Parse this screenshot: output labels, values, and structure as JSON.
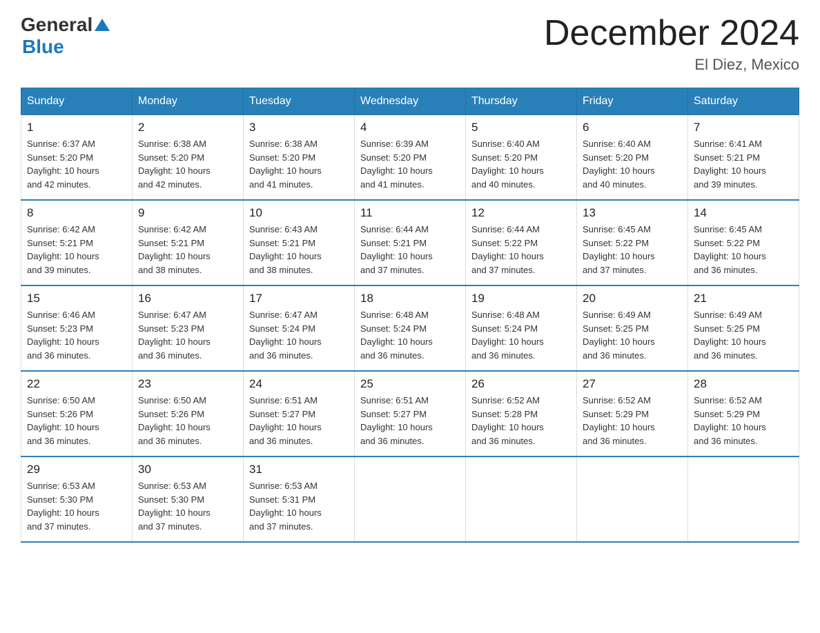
{
  "header": {
    "logo_general": "General",
    "logo_blue": "Blue",
    "month_year": "December 2024",
    "location": "El Diez, Mexico"
  },
  "days_of_week": [
    "Sunday",
    "Monday",
    "Tuesday",
    "Wednesday",
    "Thursday",
    "Friday",
    "Saturday"
  ],
  "weeks": [
    [
      {
        "day": "1",
        "sunrise": "6:37 AM",
        "sunset": "5:20 PM",
        "daylight": "10 hours and 42 minutes."
      },
      {
        "day": "2",
        "sunrise": "6:38 AM",
        "sunset": "5:20 PM",
        "daylight": "10 hours and 42 minutes."
      },
      {
        "day": "3",
        "sunrise": "6:38 AM",
        "sunset": "5:20 PM",
        "daylight": "10 hours and 41 minutes."
      },
      {
        "day": "4",
        "sunrise": "6:39 AM",
        "sunset": "5:20 PM",
        "daylight": "10 hours and 41 minutes."
      },
      {
        "day": "5",
        "sunrise": "6:40 AM",
        "sunset": "5:20 PM",
        "daylight": "10 hours and 40 minutes."
      },
      {
        "day": "6",
        "sunrise": "6:40 AM",
        "sunset": "5:20 PM",
        "daylight": "10 hours and 40 minutes."
      },
      {
        "day": "7",
        "sunrise": "6:41 AM",
        "sunset": "5:21 PM",
        "daylight": "10 hours and 39 minutes."
      }
    ],
    [
      {
        "day": "8",
        "sunrise": "6:42 AM",
        "sunset": "5:21 PM",
        "daylight": "10 hours and 39 minutes."
      },
      {
        "day": "9",
        "sunrise": "6:42 AM",
        "sunset": "5:21 PM",
        "daylight": "10 hours and 38 minutes."
      },
      {
        "day": "10",
        "sunrise": "6:43 AM",
        "sunset": "5:21 PM",
        "daylight": "10 hours and 38 minutes."
      },
      {
        "day": "11",
        "sunrise": "6:44 AM",
        "sunset": "5:21 PM",
        "daylight": "10 hours and 37 minutes."
      },
      {
        "day": "12",
        "sunrise": "6:44 AM",
        "sunset": "5:22 PM",
        "daylight": "10 hours and 37 minutes."
      },
      {
        "day": "13",
        "sunrise": "6:45 AM",
        "sunset": "5:22 PM",
        "daylight": "10 hours and 37 minutes."
      },
      {
        "day": "14",
        "sunrise": "6:45 AM",
        "sunset": "5:22 PM",
        "daylight": "10 hours and 36 minutes."
      }
    ],
    [
      {
        "day": "15",
        "sunrise": "6:46 AM",
        "sunset": "5:23 PM",
        "daylight": "10 hours and 36 minutes."
      },
      {
        "day": "16",
        "sunrise": "6:47 AM",
        "sunset": "5:23 PM",
        "daylight": "10 hours and 36 minutes."
      },
      {
        "day": "17",
        "sunrise": "6:47 AM",
        "sunset": "5:24 PM",
        "daylight": "10 hours and 36 minutes."
      },
      {
        "day": "18",
        "sunrise": "6:48 AM",
        "sunset": "5:24 PM",
        "daylight": "10 hours and 36 minutes."
      },
      {
        "day": "19",
        "sunrise": "6:48 AM",
        "sunset": "5:24 PM",
        "daylight": "10 hours and 36 minutes."
      },
      {
        "day": "20",
        "sunrise": "6:49 AM",
        "sunset": "5:25 PM",
        "daylight": "10 hours and 36 minutes."
      },
      {
        "day": "21",
        "sunrise": "6:49 AM",
        "sunset": "5:25 PM",
        "daylight": "10 hours and 36 minutes."
      }
    ],
    [
      {
        "day": "22",
        "sunrise": "6:50 AM",
        "sunset": "5:26 PM",
        "daylight": "10 hours and 36 minutes."
      },
      {
        "day": "23",
        "sunrise": "6:50 AM",
        "sunset": "5:26 PM",
        "daylight": "10 hours and 36 minutes."
      },
      {
        "day": "24",
        "sunrise": "6:51 AM",
        "sunset": "5:27 PM",
        "daylight": "10 hours and 36 minutes."
      },
      {
        "day": "25",
        "sunrise": "6:51 AM",
        "sunset": "5:27 PM",
        "daylight": "10 hours and 36 minutes."
      },
      {
        "day": "26",
        "sunrise": "6:52 AM",
        "sunset": "5:28 PM",
        "daylight": "10 hours and 36 minutes."
      },
      {
        "day": "27",
        "sunrise": "6:52 AM",
        "sunset": "5:29 PM",
        "daylight": "10 hours and 36 minutes."
      },
      {
        "day": "28",
        "sunrise": "6:52 AM",
        "sunset": "5:29 PM",
        "daylight": "10 hours and 36 minutes."
      }
    ],
    [
      {
        "day": "29",
        "sunrise": "6:53 AM",
        "sunset": "5:30 PM",
        "daylight": "10 hours and 37 minutes."
      },
      {
        "day": "30",
        "sunrise": "6:53 AM",
        "sunset": "5:30 PM",
        "daylight": "10 hours and 37 minutes."
      },
      {
        "day": "31",
        "sunrise": "6:53 AM",
        "sunset": "5:31 PM",
        "daylight": "10 hours and 37 minutes."
      },
      null,
      null,
      null,
      null
    ]
  ],
  "labels": {
    "sunrise": "Sunrise:",
    "sunset": "Sunset:",
    "daylight": "Daylight:"
  }
}
